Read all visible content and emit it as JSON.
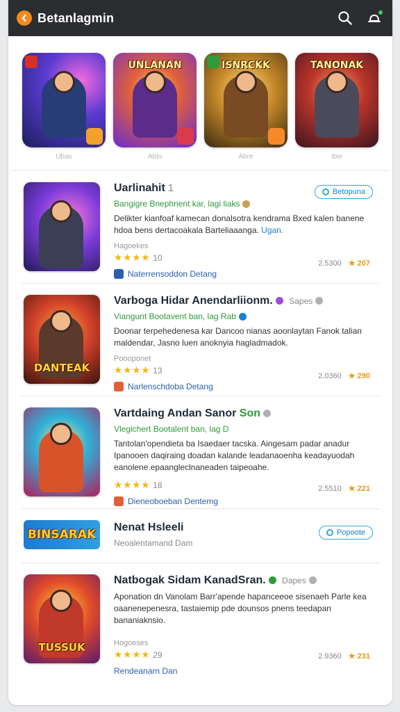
{
  "app": {
    "title": "Betanlagmin"
  },
  "featured": [
    {
      "art_text": "",
      "label": "Ubas"
    },
    {
      "art_text": "UNLANAN",
      "label": "Ablo"
    },
    {
      "art_text": "ISNRCKK",
      "label": "Abre"
    },
    {
      "art_text": "TANONAK",
      "label": "Ibie"
    }
  ],
  "items": [
    {
      "title": "Uarlinahit",
      "count": "1",
      "developer": "Bangigre Bnephnent kar, lagi liaks",
      "description": "Delikter kianfoaf kamecan donalsotra kendrama Bxed kalen banene hdoa bens dertacoakala Barteliaaanga.",
      "description_link": "Ugan.",
      "meta_label": "Hagoekes",
      "stars": "★★★★",
      "rating_count": "10",
      "category": "Naterrensoddon Detang",
      "downloads": "2.5300",
      "price": "207",
      "chip": "Betopuna",
      "art_text": ""
    },
    {
      "title": "Varboga Hidar Anendarliionm.",
      "tag": "Sapes",
      "developer": "Viangunt Bootavent ban, lag Rab",
      "description": "Doonar terpehedenesa kar Dancoo nianas aoonlaytan Fanok talian maldendar, Jasno luen anoknyia hagladmadok.",
      "description_link": "",
      "meta_label": "Poooponet",
      "stars": "★★★★",
      "rating_count": "13",
      "category": "Narlenschdoba Detang",
      "downloads": "2.0360",
      "price": "290",
      "art_text": "DANTEAK"
    },
    {
      "title": "Vartdaing Andan Sanor",
      "title_accent": "Son",
      "developer": "Vlegichert Bootalent ban, lag D",
      "description": "Tantolan'opendieta ba Isaedaer tacska. Aingesam padar anadur Ipanooen daqiraing doadan kalande leadanaoenha keadayuodah eanolene.epaangleclnaneaden taipeoahe.",
      "description_link": "",
      "meta_label": "",
      "stars": "★★★★",
      "rating_count": "18",
      "category": "Dieneoboeban Dentemg",
      "downloads": "2.5510",
      "price": "221",
      "art_text": ""
    }
  ],
  "banner": {
    "title": "Nenat Hsleeli",
    "subtitle": "Neoalentamand Dam",
    "chip": "Popoote",
    "art_text": "BINSARAK"
  },
  "last_item": {
    "title": "Natbogak Sidam KanadSran.",
    "tag": "Dapes",
    "description": "Aponation dn Vanolam Barr'apende hapanceeoe sisenaeh Parle kea oaanenepenesra, tastaiemip pde dounsos pnens teedapan bananiaknsio.",
    "meta_label": "Hogoeses",
    "stars": "★★★★",
    "rating_count": "29",
    "category": "Rendeanarn Dan",
    "downloads": "2.9360",
    "price": "231",
    "art_text": "TUSSUK"
  },
  "colors": {
    "appbar": "#2b2d31",
    "accent": "#f28a1e",
    "star": "#f2b81a",
    "link": "#1a7fd4",
    "developer": "#2e9a3a"
  },
  "icons": {
    "logo": "app-logo-icon",
    "search": "search-icon",
    "notifications": "bell-icon"
  }
}
